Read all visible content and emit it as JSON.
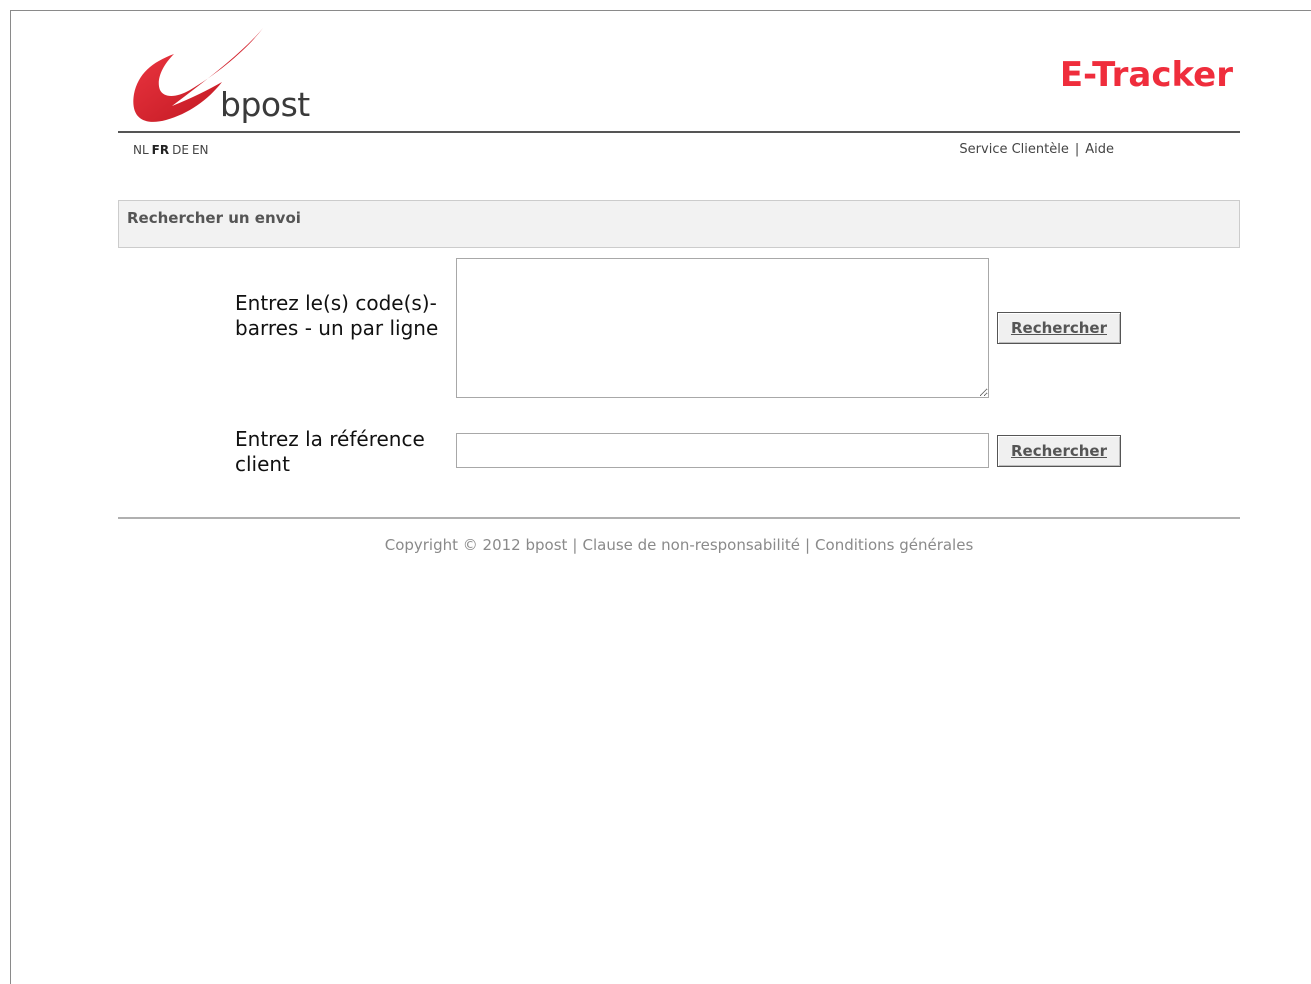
{
  "brand": {
    "logo_text": "bpost",
    "logo_color": "#e2202a",
    "app_title": "E-Tracker",
    "app_title_color": "#ef2d3c"
  },
  "languages": [
    {
      "code": "NL",
      "active": false
    },
    {
      "code": "FR",
      "active": true
    },
    {
      "code": "DE",
      "active": false
    },
    {
      "code": "EN",
      "active": false
    }
  ],
  "top_links": {
    "customer_service": "Service Clientèle",
    "separator": "|",
    "help": "Aide"
  },
  "section": {
    "title": "Rechercher un envoi"
  },
  "form": {
    "barcode_label": "Entrez le(s) code(s)-barres - un par ligne",
    "barcode_value": "",
    "barcode_button": "Rechercher",
    "reference_label": "Entrez la référence client",
    "reference_value": "",
    "reference_button": "Rechercher"
  },
  "footer": {
    "copyright": "Copyright © 2012 bpost",
    "separator": "|",
    "disclaimer": "Clause de non-responsabilité",
    "terms": "Conditions générales"
  }
}
